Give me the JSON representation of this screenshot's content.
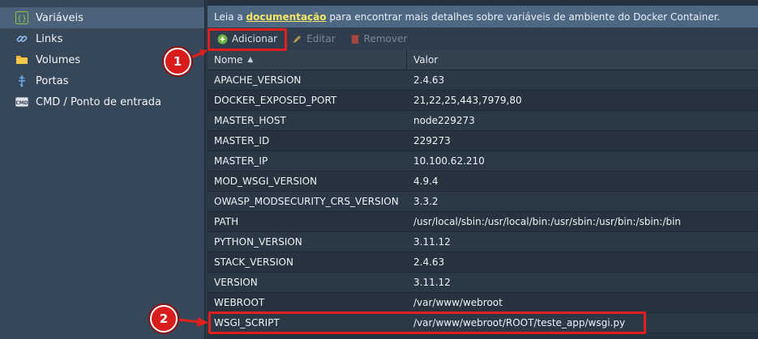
{
  "sidebar": {
    "items": [
      {
        "label": "Variáveis",
        "icon": "braces-icon",
        "active": true
      },
      {
        "label": "Links",
        "icon": "link-icon",
        "active": false
      },
      {
        "label": "Volumes",
        "icon": "folder-icon",
        "active": false
      },
      {
        "label": "Portas",
        "icon": "usb-port-icon",
        "active": false
      },
      {
        "label": "CMD / Ponto de entrada",
        "icon": "cmd-icon",
        "active": false
      }
    ]
  },
  "info": {
    "prefix": "Leia a ",
    "link": "documentação",
    "suffix": " para encontrar mais detalhes sobre variáveis de ambiente do Docker Container."
  },
  "toolbar": {
    "add_label": "Adicionar",
    "edit_label": "Editar",
    "remove_label": "Remover"
  },
  "table": {
    "headers": {
      "name": "Nome",
      "value": "Valor"
    },
    "rows": [
      {
        "name": "APACHE_VERSION",
        "value": "2.4.63"
      },
      {
        "name": "DOCKER_EXPOSED_PORT",
        "value": "21,22,25,443,7979,80"
      },
      {
        "name": "MASTER_HOST",
        "value": "node229273"
      },
      {
        "name": "MASTER_ID",
        "value": "229273"
      },
      {
        "name": "MASTER_IP",
        "value": "10.100.62.210"
      },
      {
        "name": "MOD_WSGI_VERSION",
        "value": "4.9.4"
      },
      {
        "name": "OWASP_MODSECURITY_CRS_VERSION",
        "value": "3.3.2"
      },
      {
        "name": "PATH",
        "value": "/usr/local/sbin:/usr/local/bin:/usr/sbin:/usr/bin:/sbin:/bin"
      },
      {
        "name": "PYTHON_VERSION",
        "value": "3.11.12"
      },
      {
        "name": "STACK_VERSION",
        "value": "2.4.63"
      },
      {
        "name": "VERSION",
        "value": "3.11.12"
      },
      {
        "name": "WEBROOT",
        "value": "/var/www/webroot"
      },
      {
        "name": "WSGI_SCRIPT",
        "value": "/var/www/webroot/ROOT/teste_app/wsgi.py"
      }
    ]
  },
  "annotations": {
    "badge1": "1",
    "badge2": "2",
    "color": "#e0201c"
  }
}
